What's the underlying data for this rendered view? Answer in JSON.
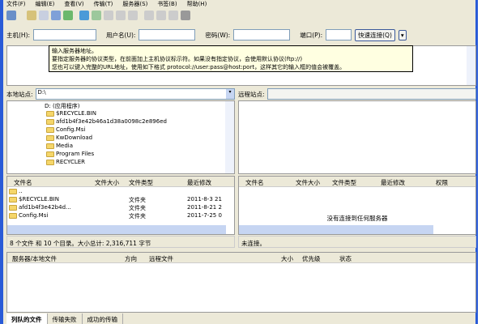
{
  "menu": [
    "文件(F)",
    "编辑(E)",
    "查看(V)",
    "传输(T)",
    "服务器(S)",
    "书签(B)",
    "帮助(H)"
  ],
  "quickconnect": {
    "host_label": "主机(H):",
    "user_label": "用户名(U):",
    "pass_label": "密码(W):",
    "port_label": "端口(P):",
    "connect": "快速连接(Q)"
  },
  "tooltip": [
    "输入服务器地址。",
    "要指定服务器的协议类型，在前面加上主机协议标示符。如果没有指定协议，会使用默认协议(ftp://)",
    "您也可以键入完整的URL地址，使用如下格式 protocol://user:pass@host:port，这样其它的输入框的值会被覆盖。"
  ],
  "local": {
    "label": "本地站点:",
    "path": "D:\\",
    "tree": [
      "D: (应用程序)",
      "$RECYCLE.BIN",
      "afd1b4f3e42b46a1d38a0098c2e896ed",
      "Config.Msi",
      "KwDownload",
      "Media",
      "Program Files",
      "RECYCLER"
    ],
    "columns": [
      "文件名",
      "文件大小",
      "文件类型",
      "最近修改"
    ],
    "files": [
      {
        "name": ".."
      },
      {
        "name": "$RECYCLE.BIN",
        "type": "文件夹",
        "date": "2011-8-3 21"
      },
      {
        "name": "afd1b4f3e42b4d...",
        "type": "文件夹",
        "date": "2011-8-21 2"
      },
      {
        "name": "Config.Msi",
        "type": "文件夹",
        "date": "2011-7-25 0"
      }
    ],
    "status": "8 个文件 和 10 个目录。大小总计: 2,316,711 字节"
  },
  "remote": {
    "label": "远程站点:",
    "columns": [
      "文件名",
      "文件大小",
      "文件类型",
      "最近修改",
      "权限"
    ],
    "empty": "没有连接到任何服务器",
    "status": "未连接。"
  },
  "queue": {
    "columns": [
      "服务器/本地文件",
      "方向",
      "远程文件",
      "大小",
      "优先级",
      "状态"
    ],
    "tabs": [
      "列队的文件",
      "传输失败",
      "成功的传输"
    ]
  }
}
